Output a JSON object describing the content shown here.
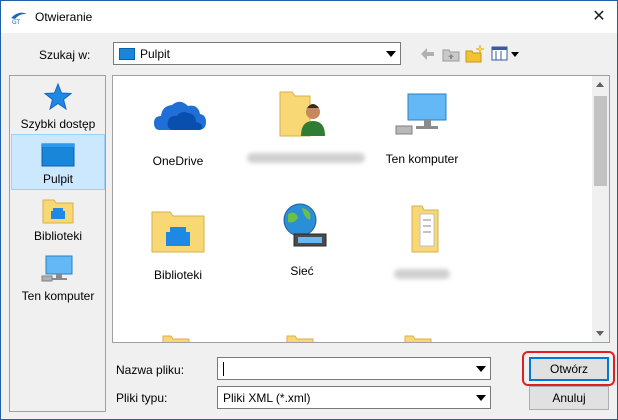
{
  "window": {
    "title": "Otwieranie"
  },
  "toolbar": {
    "look_in_label": "Szukaj w:",
    "look_in_value": "Pulpit"
  },
  "places": [
    {
      "label": "Szybki dostęp",
      "icon": "quick-access-star-icon"
    },
    {
      "label": "Pulpit",
      "icon": "desktop-icon",
      "selected": true
    },
    {
      "label": "Biblioteki",
      "icon": "libraries-icon"
    },
    {
      "label": "Ten komputer",
      "icon": "this-pc-icon"
    }
  ],
  "files": [
    {
      "name": "OneDrive",
      "icon": "onedrive-cloud-icon"
    },
    {
      "name": "",
      "icon": "user-folder-icon",
      "blurred": true
    },
    {
      "name": "Ten komputer",
      "icon": "this-pc-icon"
    },
    {
      "name": "Biblioteki",
      "icon": "libraries-folder-icon"
    },
    {
      "name": "Sieć",
      "icon": "network-globe-icon"
    },
    {
      "name": "",
      "icon": "folder-icon",
      "blurred": true
    }
  ],
  "bottom": {
    "filename_label": "Nazwa pliku:",
    "filename_value": "",
    "filetype_label": "Pliki typu:",
    "filetype_value": "Pliki XML (*.xml)",
    "open_label": "Otwórz",
    "cancel_label": "Anuluj"
  },
  "colors": {
    "accent": "#0078d7",
    "highlight": "#e02020",
    "folder": "#f8d775",
    "selection": "#cce8ff"
  }
}
